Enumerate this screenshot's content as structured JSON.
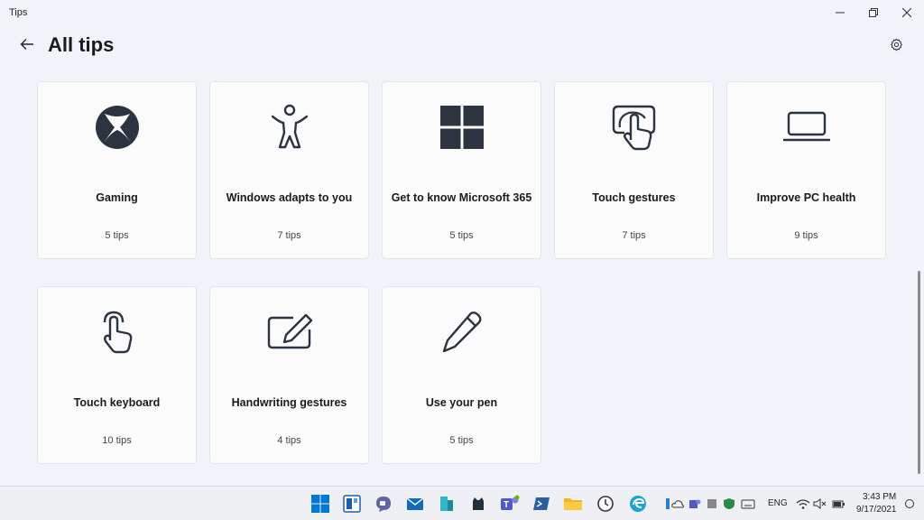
{
  "window": {
    "app_title": "Tips",
    "page_title": "All tips"
  },
  "cards": [
    {
      "title": "Gaming",
      "count": "5 tips",
      "icon": "xbox-icon"
    },
    {
      "title": "Windows adapts to you",
      "count": "7 tips",
      "icon": "accessibility-icon"
    },
    {
      "title": "Get to know Microsoft 365",
      "count": "5 tips",
      "icon": "windows-logo-icon"
    },
    {
      "title": "Touch gestures",
      "count": "7 tips",
      "icon": "touch-gesture-icon"
    },
    {
      "title": "Improve PC health",
      "count": "9 tips",
      "icon": "laptop-icon"
    },
    {
      "title": "Touch keyboard",
      "count": "10 tips",
      "icon": "touch-hand-icon"
    },
    {
      "title": "Handwriting gestures",
      "count": "4 tips",
      "icon": "handwriting-icon"
    },
    {
      "title": "Use your pen",
      "count": "5 tips",
      "icon": "pen-icon"
    }
  ],
  "taskbar": {
    "language": "ENG",
    "time": "3:43 PM",
    "date": "9/17/2021"
  },
  "colors": {
    "icon": "#2b3440",
    "background": "#f0f3f7",
    "card": "#fbfbfc",
    "accent": "#0067c0"
  }
}
